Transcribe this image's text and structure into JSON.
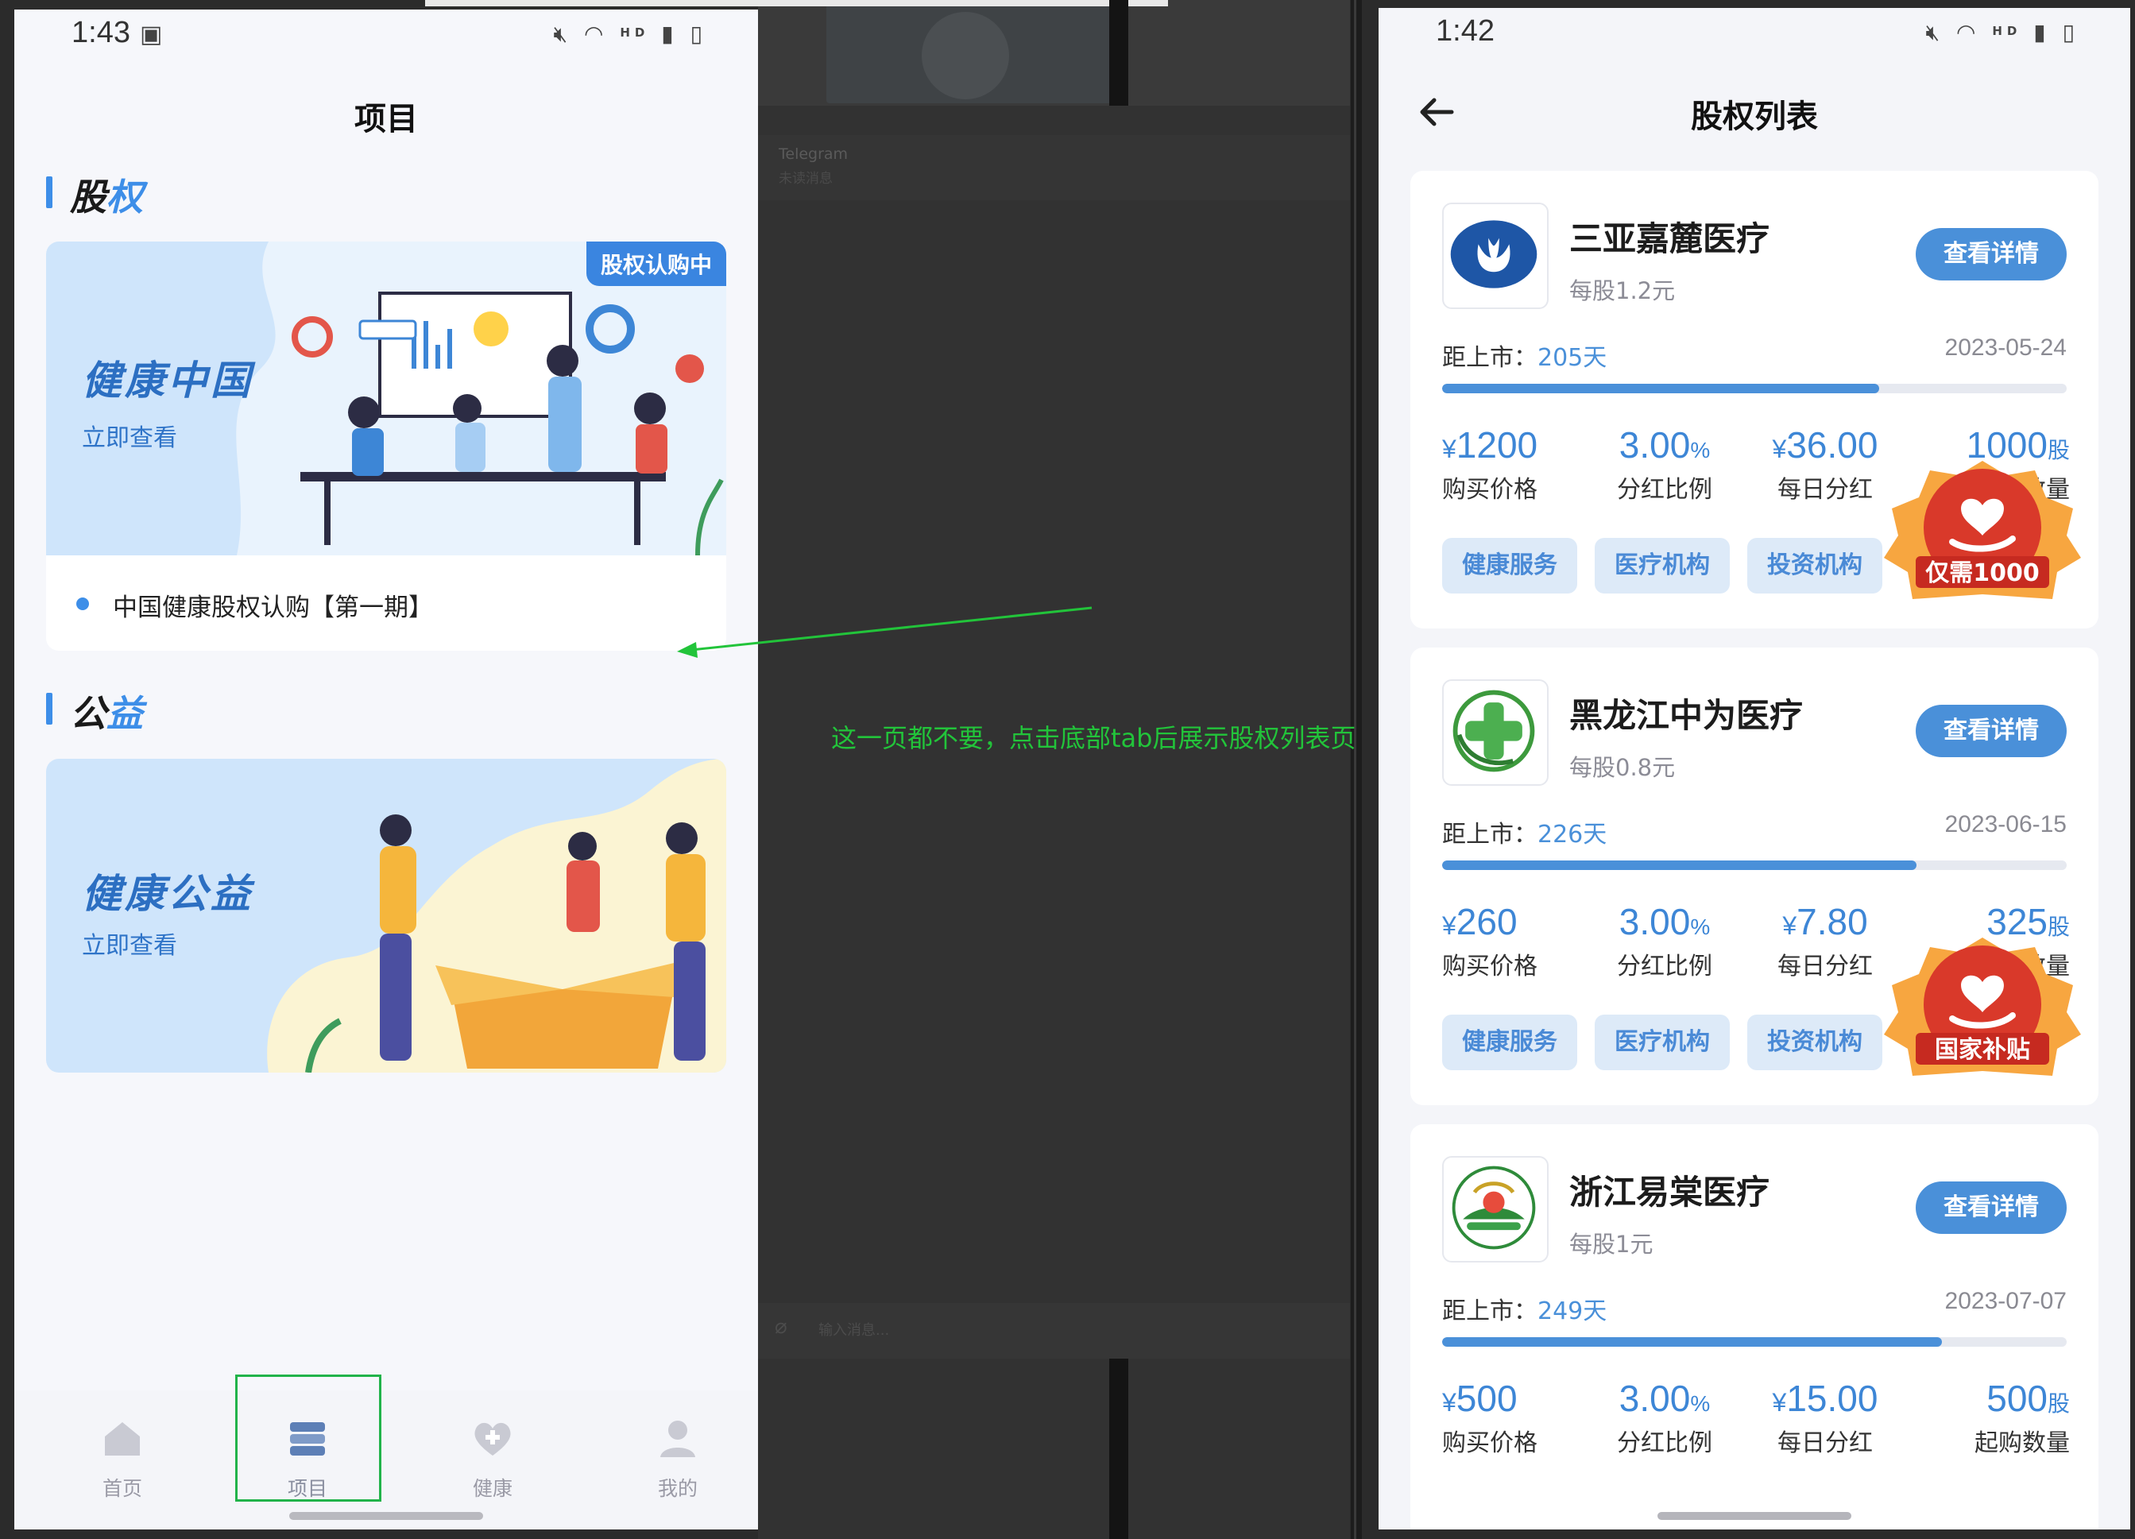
{
  "left_screen": {
    "status": {
      "time": "1:43",
      "hd": "HD"
    },
    "page_title": "项目",
    "section_equity": {
      "text_main": "股",
      "text_accent": "权"
    },
    "banner_equity": {
      "title": "健康中国",
      "subtitle": "立即查看",
      "tag": "股权认购中",
      "caption": "中国健康股权认购【第一期】"
    },
    "section_welfare": {
      "text_main": "公",
      "text_accent": "益"
    },
    "banner_welfare": {
      "title": "健康公益",
      "subtitle": "立即查看"
    },
    "tabs": [
      {
        "label": "首页",
        "icon": "home-icon"
      },
      {
        "label": "项目",
        "icon": "project-icon"
      },
      {
        "label": "健康",
        "icon": "heart-plus-icon"
      },
      {
        "label": "我的",
        "icon": "user-icon"
      }
    ],
    "active_tab": "项目"
  },
  "middle": {
    "telegram": "Telegram",
    "telegram_sub": "未读消息",
    "input_hint": "输入消息..."
  },
  "annotation": {
    "text": "这一页都不要，点击底部tab后展示股权列表页",
    "color": "#22c43a"
  },
  "right_screen": {
    "status": {
      "time": "1:42",
      "hd": "HD"
    },
    "page_title": "股权列表",
    "detail_button": "查看详情",
    "countdown_label": "距上市：",
    "stat_labels": [
      "购买价格",
      "分红比例",
      "每日分红",
      "起购数量"
    ],
    "tags": [
      "健康服务",
      "医疗机构",
      "投资机构"
    ],
    "cards": [
      {
        "name": "三亚嘉麓医疗",
        "price_per_share": "每股1.2元",
        "days": "205天",
        "date": "2023-05-24",
        "progress": 0.7,
        "purchase_price": "1200",
        "dividend_ratio": "3.00",
        "daily_dividend": "36.00",
        "min_shares": "1000",
        "seal_text": "仅需1000",
        "logo": "lotus-logo"
      },
      {
        "name": "黑龙江中为医疗",
        "price_per_share": "每股0.8元",
        "days": "226天",
        "date": "2023-06-15",
        "progress": 0.76,
        "purchase_price": "260",
        "dividend_ratio": "3.00",
        "daily_dividend": "7.80",
        "min_shares": "325",
        "seal_text": "国家补贴",
        "logo": "green-cross-logo"
      },
      {
        "name": "浙江易棠医疗",
        "price_per_share": "每股1元",
        "days": "249天",
        "date": "2023-07-07",
        "progress": 0.8,
        "purchase_price": "500",
        "dividend_ratio": "3.00",
        "daily_dividend": "15.00",
        "min_shares": "500",
        "logo": "wheat-logo"
      }
    ],
    "symbols": {
      "yen": "¥",
      "percent": "%",
      "shares": "股"
    }
  },
  "colors": {
    "accent": "#3d8ee8",
    "button": "#4a90d9",
    "annotation": "#22c43a",
    "seal": "#d9392a"
  }
}
